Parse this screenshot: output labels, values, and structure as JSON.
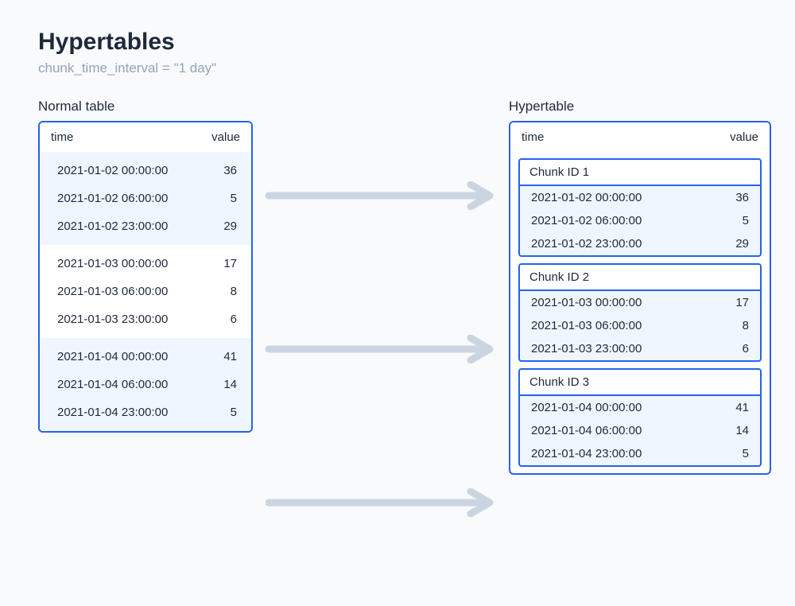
{
  "title": "Hypertables",
  "subtitle": "chunk_time_interval = \"1 day\"",
  "labels": {
    "normal": "Normal table",
    "hyper": "Hypertable"
  },
  "columns": {
    "time": "time",
    "value": "value"
  },
  "normal": {
    "groups": [
      {
        "shaded": true,
        "rows": [
          {
            "t": "2021-01-02 00:00:00",
            "v": "36"
          },
          {
            "t": "2021-01-02 06:00:00",
            "v": "5"
          },
          {
            "t": "2021-01-02 23:00:00",
            "v": "29"
          }
        ]
      },
      {
        "shaded": false,
        "rows": [
          {
            "t": "2021-01-03 00:00:00",
            "v": "17"
          },
          {
            "t": "2021-01-03 06:00:00",
            "v": "8"
          },
          {
            "t": "2021-01-03 23:00:00",
            "v": "6"
          }
        ]
      },
      {
        "shaded": true,
        "rows": [
          {
            "t": "2021-01-04 00:00:00",
            "v": "41"
          },
          {
            "t": "2021-01-04 06:00:00",
            "v": "14"
          },
          {
            "t": "2021-01-04 23:00:00",
            "v": "5"
          }
        ]
      }
    ]
  },
  "hyper": {
    "chunks": [
      {
        "label": "Chunk ID 1",
        "rows": [
          {
            "t": "2021-01-02 00:00:00",
            "v": "36"
          },
          {
            "t": "2021-01-02 06:00:00",
            "v": "5"
          },
          {
            "t": "2021-01-02 23:00:00",
            "v": "29"
          }
        ]
      },
      {
        "label": "Chunk ID 2",
        "rows": [
          {
            "t": "2021-01-03 00:00:00",
            "v": "17"
          },
          {
            "t": "2021-01-03 06:00:00",
            "v": "8"
          },
          {
            "t": "2021-01-03 23:00:00",
            "v": "6"
          }
        ]
      },
      {
        "label": "Chunk ID 3",
        "rows": [
          {
            "t": "2021-01-04 00:00:00",
            "v": "41"
          },
          {
            "t": "2021-01-04 06:00:00",
            "v": "14"
          },
          {
            "t": "2021-01-04 23:00:00",
            "v": "5"
          }
        ]
      }
    ]
  }
}
